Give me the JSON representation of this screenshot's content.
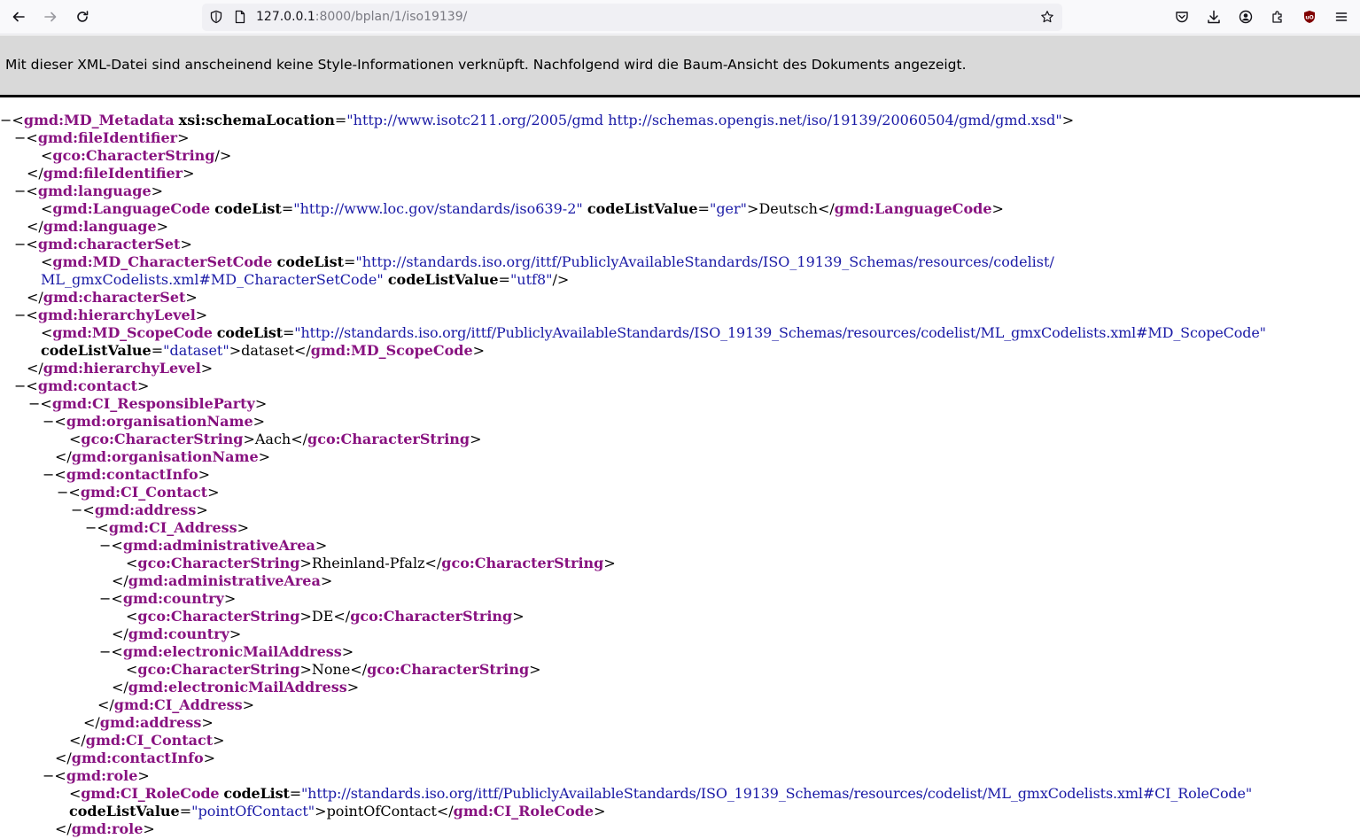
{
  "browser": {
    "url_host": "127.0.0.1",
    "url_rest": ":8000/bplan/1/iso19139/",
    "icons": [
      "back-icon",
      "forward-icon",
      "reload-icon",
      "shield-icon",
      "page-icon",
      "bookmark-star-icon",
      "pocket-icon",
      "download-icon",
      "account-icon",
      "extensions-icon",
      "ublock-icon",
      "menu-icon"
    ]
  },
  "banner": {
    "text": "Mit dieser XML-Datei sind anscheinend keine Style-Informationen verknüpft. Nachfolgend wird die Baum-Ansicht des Dokuments angezeigt."
  },
  "xml": {
    "root_tag": "gmd:MD_Metadata",
    "root_attr": "xsi:schemaLocation",
    "root_attr_value": "\"http://www.isotc211.org/2005/gmd http://schemas.opengis.net/iso/19139/20060504/gmd/gmd.xsd\"",
    "fileIdentifier": "gmd:fileIdentifier",
    "characterString": "gco:CharacterString",
    "language": "gmd:language",
    "languageCode": "gmd:LanguageCode",
    "codeList": "codeList",
    "codeListValue": "codeListValue",
    "lang_codelist": "\"http://www.loc.gov/standards/iso639-2\"",
    "lang_value": "\"ger\"",
    "lang_text": "Deutsch",
    "characterSet": "gmd:characterSet",
    "charsetCode": "gmd:MD_CharacterSetCode",
    "charset_codelist_1": "\"http://standards.iso.org/ittf/PubliclyAvailableStandards/ISO_19139_Schemas/resources/codelist/",
    "charset_codelist_2": "ML_gmxCodelists.xml#MD_CharacterSetCode\"",
    "charset_value": "\"utf8\"",
    "hierarchyLevel": "gmd:hierarchyLevel",
    "scopeCode": "gmd:MD_ScopeCode",
    "scope_codelist": "\"http://standards.iso.org/ittf/PubliclyAvailableStandards/ISO_19139_Schemas/resources/codelist/ML_gmxCodelists.xml#MD_ScopeCode\"",
    "scope_value": "\"dataset\"",
    "scope_text": "dataset",
    "contact": "gmd:contact",
    "responsibleParty": "gmd:CI_ResponsibleParty",
    "organisationName": "gmd:organisationName",
    "org_text": "Aach",
    "contactInfo": "gmd:contactInfo",
    "ciContact": "gmd:CI_Contact",
    "address": "gmd:address",
    "ciAddress": "gmd:CI_Address",
    "administrativeArea": "gmd:administrativeArea",
    "area_text": "Rheinland-Pfalz",
    "country": "gmd:country",
    "country_text": "DE",
    "email": "gmd:electronicMailAddress",
    "email_text": "None",
    "role": "gmd:role",
    "roleCode": "gmd:CI_RoleCode",
    "role_codelist": "\"http://standards.iso.org/ittf/PubliclyAvailableStandards/ISO_19139_Schemas/resources/codelist/ML_gmxCodelists.xml#CI_RoleCode\"",
    "role_value": "\"pointOfContact\"",
    "role_text": "pointOfContact"
  }
}
